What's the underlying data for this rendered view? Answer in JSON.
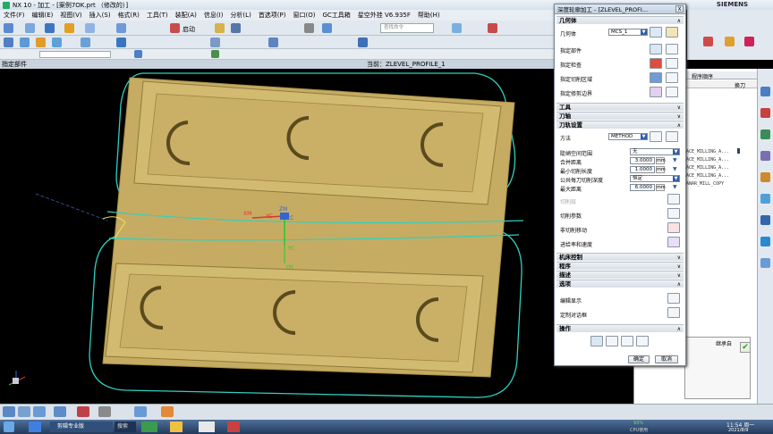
{
  "window": {
    "title": "NX 10 - 加工 - [案例7OK.prt （修改的）]",
    "brand": "SIEMENS"
  },
  "menu": [
    "文件(F)",
    "编辑(E)",
    "视图(V)",
    "插入(S)",
    "格式(R)",
    "工具(T)",
    "装配(A)",
    "信息(I)",
    "分析(L)",
    "首选项(P)",
    "窗口(O)",
    "GC工具箱",
    "星空外挂 V6.935F",
    "帮助(H)"
  ],
  "toolbar": {
    "start_label": "启动",
    "search_placeholder": "查找命令"
  },
  "status": {
    "left": "指定部件",
    "center": "当前：ZLEVEL_PROFILE_1"
  },
  "viewport": {
    "labels": {
      "xm": "XM",
      "xc": "XC",
      "zm": "ZM",
      "zc": "ZC",
      "yc": "YC",
      "ym": "YM"
    },
    "colors": {
      "part": "#c6ac62",
      "part_dark": "#8f7a3c",
      "part_edge": "#d9c27a",
      "toolpath": "#2fd0c0"
    }
  },
  "dialog": {
    "title": "深度轮廓加工 - [ZLEVEL_PROFI...",
    "close": "X",
    "sections": {
      "geometry": "几何体",
      "tool": "工具",
      "axis": "刀轴",
      "path_settings": "刀轨设置",
      "machine_control": "机床控制",
      "program": "程序",
      "description": "描述",
      "options": "选项",
      "actions": "操作"
    },
    "geometry_rows": {
      "geometry_label": "几何体",
      "geometry_value": "MCS_1",
      "specify_part": "指定部件",
      "specify_check": "指定检查",
      "specify_cut_area": "指定切削区域",
      "specify_trim": "指定修剪边界"
    },
    "path": {
      "method_label": "方法",
      "method_value": "METHOD",
      "steep_label": "陡峭空间范围",
      "steep_value": "无",
      "merge_label": "合并距离",
      "merge_value": "3.0000",
      "min_cut_label": "最小切削长度",
      "min_cut_value": "1.0000",
      "depth_label": "公共每刀切削深度",
      "depth_value": "恒定",
      "max_dist_label": "最大距离",
      "max_dist_value": "6.0000",
      "unit": "mm",
      "cut_layers": "切削层",
      "cut_params": "切削参数",
      "non_cut_moves": "非切削移动",
      "feeds_speeds": "进给率和速度"
    },
    "options_rows": {
      "edit_display": "编辑显示",
      "custom_dialog": "定制对话框"
    },
    "buttons": {
      "ok": "确定",
      "cancel": "取消"
    }
  },
  "navigator": {
    "header": "程序顺序",
    "col2": "换刀",
    "rows": [
      "ACE_MILLING_A...",
      "ACE_MILLING_A...",
      "ACE_MILLING_A...",
      "ACE_MILLING_A...",
      "ANAR_MILL_COPY"
    ],
    "inherit": "继承自"
  },
  "taskbar": {
    "clip_app": "剪辑专业版",
    "search": "搜索",
    "time": "11:54 周一",
    "date": "2021/8/9",
    "cpu": "93%",
    "cpu_label": "CPU使用"
  }
}
